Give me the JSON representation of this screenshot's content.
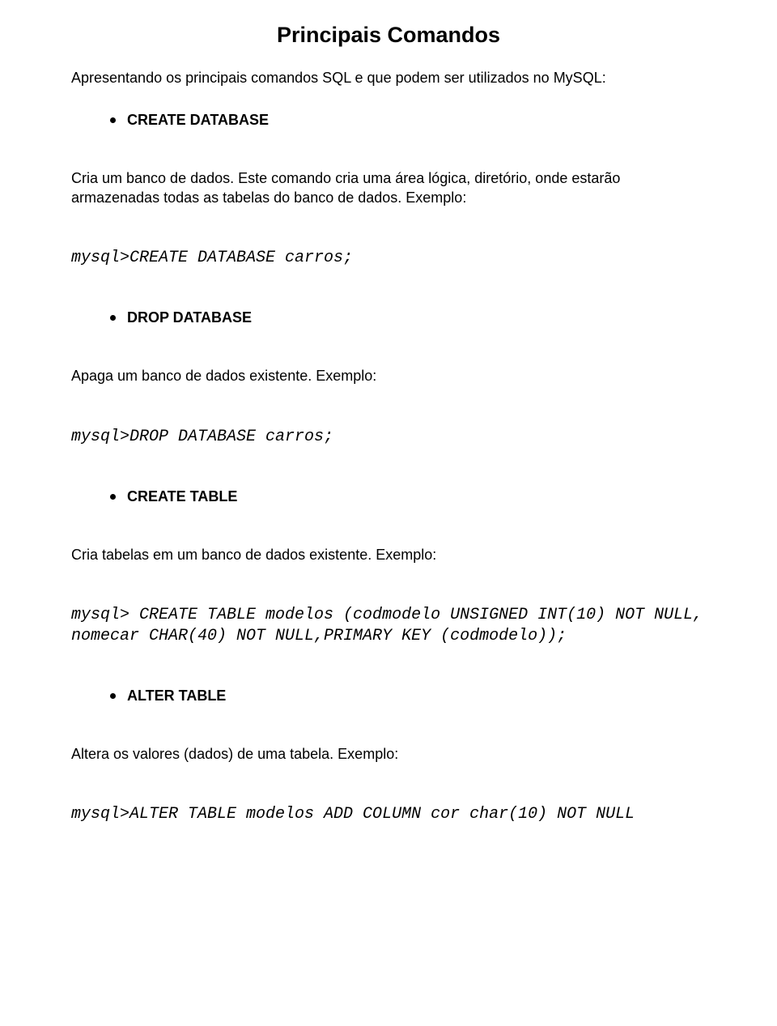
{
  "title": "Principais Comandos",
  "intro": "Apresentando os principais comandos SQL e que podem ser utilizados no MySQL:",
  "sections": {
    "s0": {
      "bullet": "CREATE DATABASE",
      "desc": "Cria um banco de dados. Este comando cria uma área lógica, diretório, onde estarão armazenadas todas as tabelas do banco de dados. Exemplo:",
      "code": "mysql>CREATE DATABASE carros;"
    },
    "s1": {
      "bullet": "DROP DATABASE",
      "desc": "Apaga um banco de dados existente. Exemplo:",
      "code": "mysql>DROP DATABASE carros;"
    },
    "s2": {
      "bullet": "CREATE TABLE",
      "desc": "Cria tabelas em um banco de dados existente. Exemplo:",
      "code": "mysql> CREATE TABLE modelos (codmodelo UNSIGNED INT(10) NOT NULL, nomecar CHAR(40) NOT NULL,PRIMARY KEY (codmodelo));"
    },
    "s3": {
      "bullet": "ALTER TABLE",
      "desc": "Altera os valores (dados) de uma tabela. Exemplo:",
      "code": "mysql>ALTER TABLE modelos ADD COLUMN cor char(10) NOT NULL"
    }
  }
}
